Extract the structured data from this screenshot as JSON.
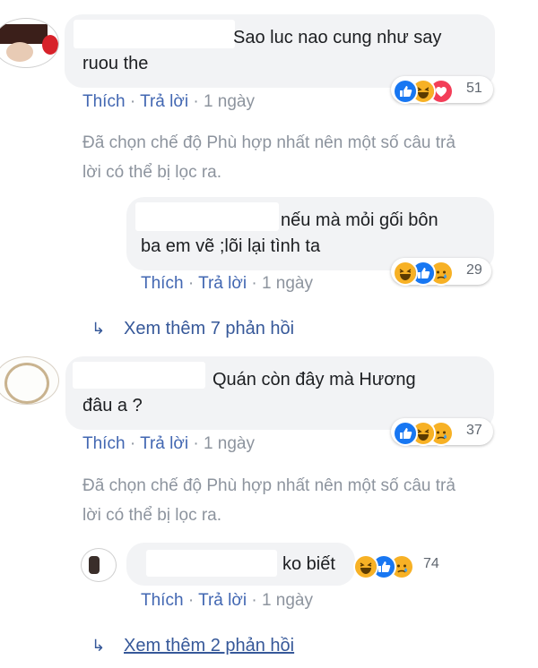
{
  "comments": [
    {
      "text_line1": "Sao luc nao cung như say",
      "text_line2": "ruou the",
      "action_like": "Thích",
      "action_reply": "Trả lời",
      "time": "1 ngày",
      "reactions": [
        "like",
        "haha",
        "love"
      ],
      "reaction_count": "51"
    },
    {
      "text_line1": "nếu mà mỏi gối bôn",
      "text_line2": "ba em vẽ ;lõi lại tình ta",
      "action_like": "Thích",
      "action_reply": "Trả lời",
      "time": "1 ngày",
      "reactions": [
        "haha",
        "like",
        "sad"
      ],
      "reaction_count": "29"
    },
    {
      "text_line1": "Quán còn đây mà Hương",
      "text_line2": "đâu a ?",
      "action_like": "Thích",
      "action_reply": "Trả lời",
      "time": "1 ngày",
      "reactions": [
        "like",
        "haha",
        "sad"
      ],
      "reaction_count": "37"
    },
    {
      "text_line1": "ko biết",
      "text_line2": "",
      "action_like": "Thích",
      "action_reply": "Trả lời",
      "time": "1 ngày",
      "reactions": [
        "haha",
        "like",
        "sad"
      ],
      "reaction_count": "74"
    }
  ],
  "filter_notice": {
    "line1": "Đã chọn chế độ Phù hợp nhất nên một số câu trả",
    "line2": "lời có thể bị lọc ra."
  },
  "view_more": [
    {
      "label": "Xem thêm 7 phản hồi"
    },
    {
      "label": "Xem thêm 2 phản hồi"
    }
  ],
  "separator": "·",
  "icons": {
    "reply_arrow": "reply-arrow-icon"
  },
  "colors": {
    "link": "#4267b2",
    "view_more": "#365899",
    "muted": "#8d949e",
    "bubble": "#f2f3f5",
    "like": "#1877f2",
    "love": "#f33e58",
    "haha": "#f7b125"
  }
}
